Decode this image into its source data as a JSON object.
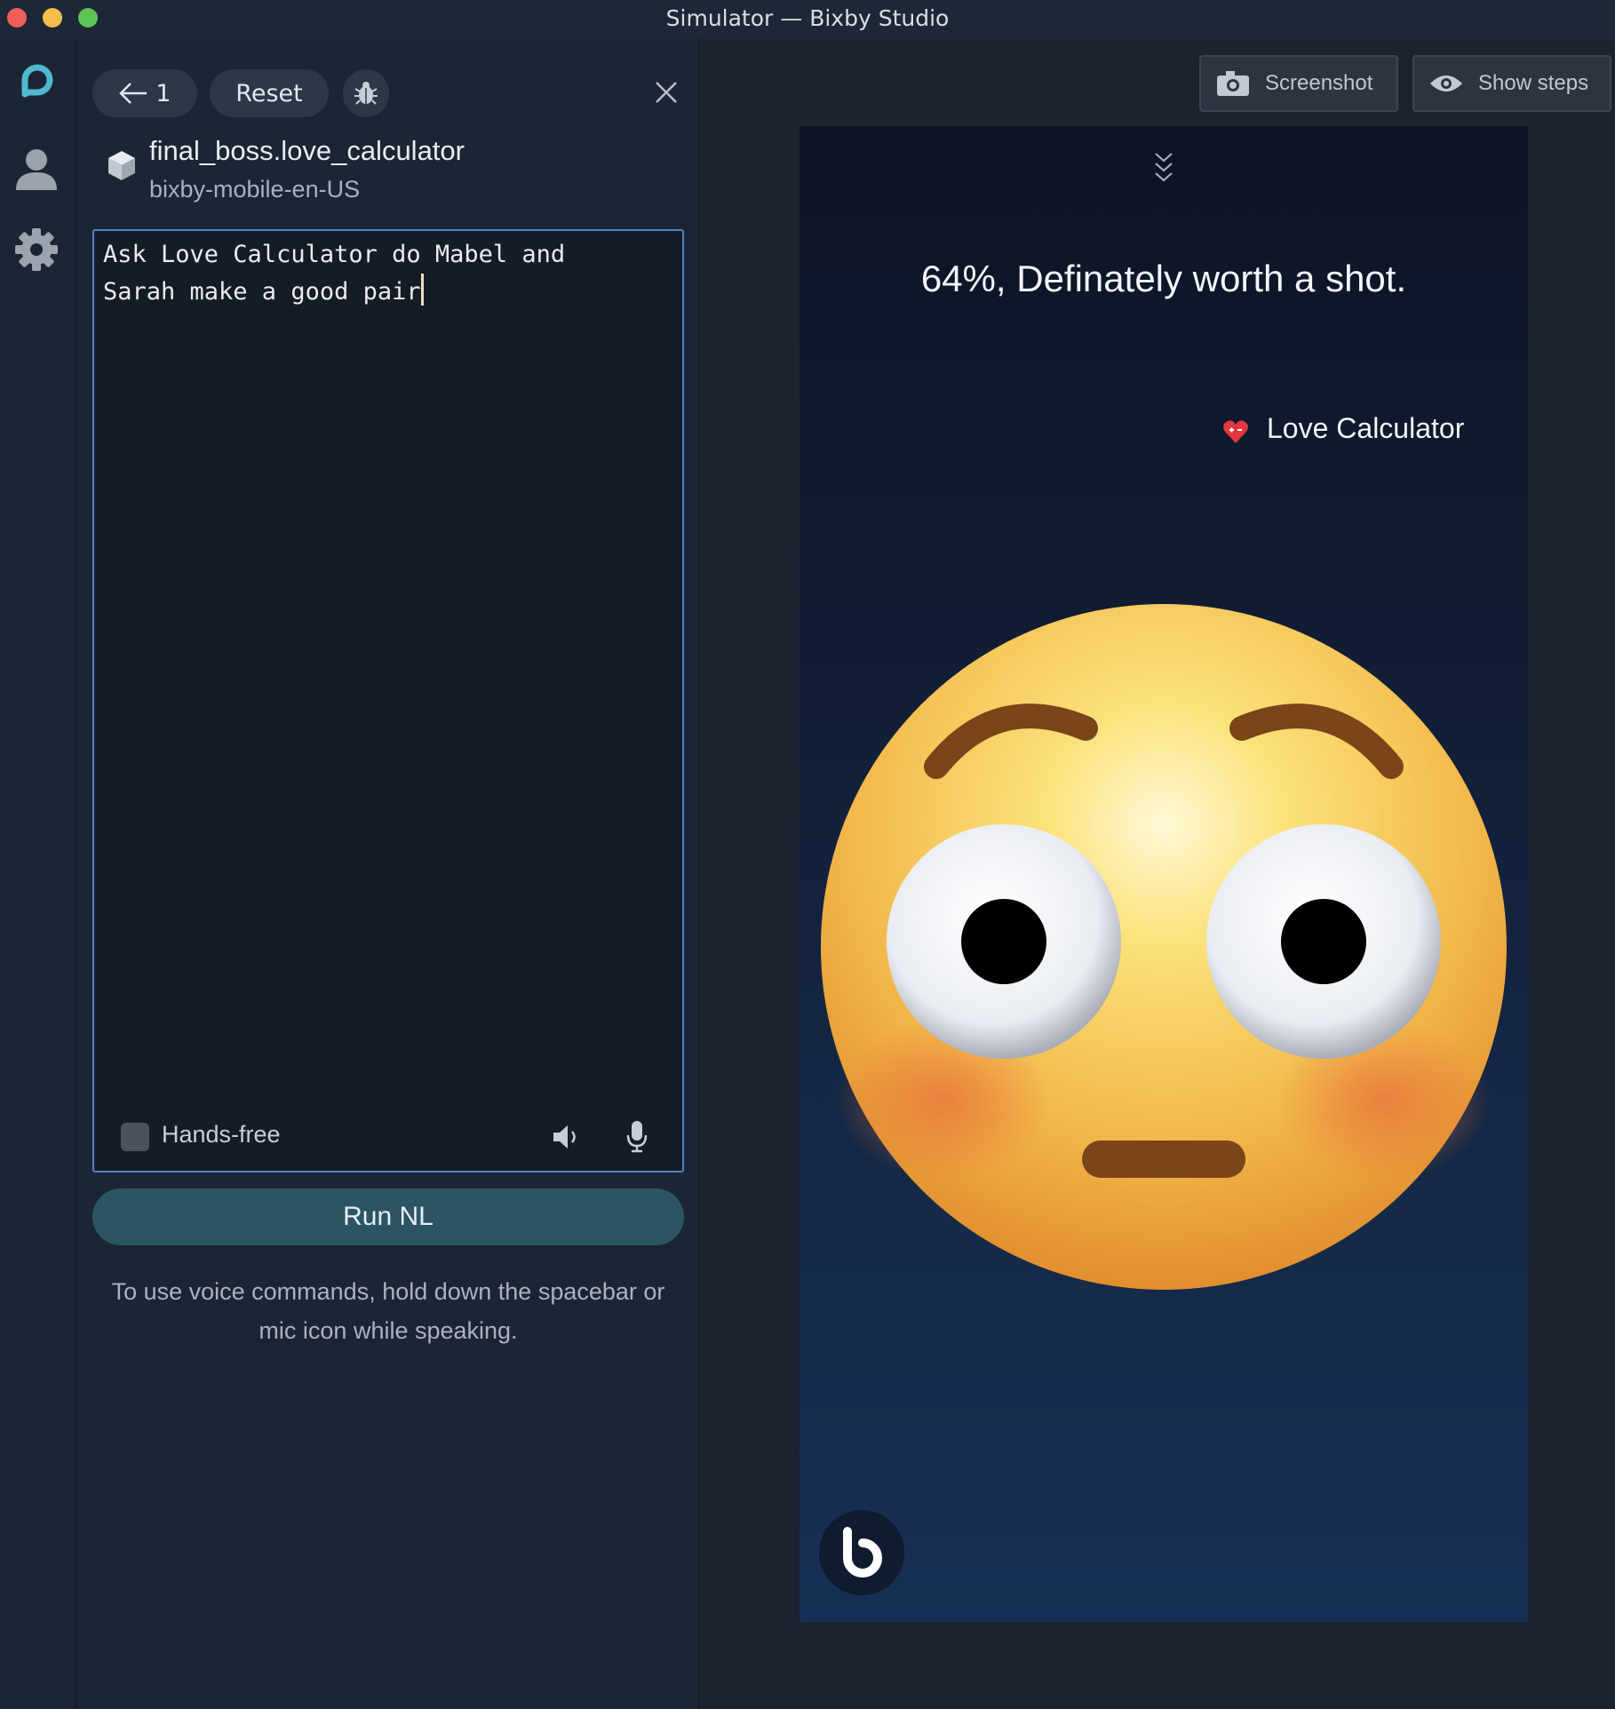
{
  "window": {
    "title": "Simulator — Bixby Studio"
  },
  "toolbar": {
    "back_count": "1",
    "reset_label": "Reset"
  },
  "capsule": {
    "name": "final_boss.love_calculator",
    "target": "bixby-mobile-en-US"
  },
  "input": {
    "utterance": "Ask Love Calculator do Mabel and\nSarah make a good pair",
    "handsfree_label": "Hands-free",
    "handsfree_checked": false
  },
  "run_button": {
    "label": "Run NL"
  },
  "hint": {
    "text": "To use voice commands, hold down the spacebar or mic icon while speaking."
  },
  "simulator_toolbar": {
    "screenshot_label": "Screenshot",
    "show_steps_label": "Show steps"
  },
  "device": {
    "answer": "64%, Definately worth a shot.",
    "app_name": "Love Calculator",
    "emoji": "flushed-face"
  },
  "colors": {
    "accent": "#4f81c9",
    "run_button": "#2b5565",
    "brand": "#4fb9cf"
  }
}
